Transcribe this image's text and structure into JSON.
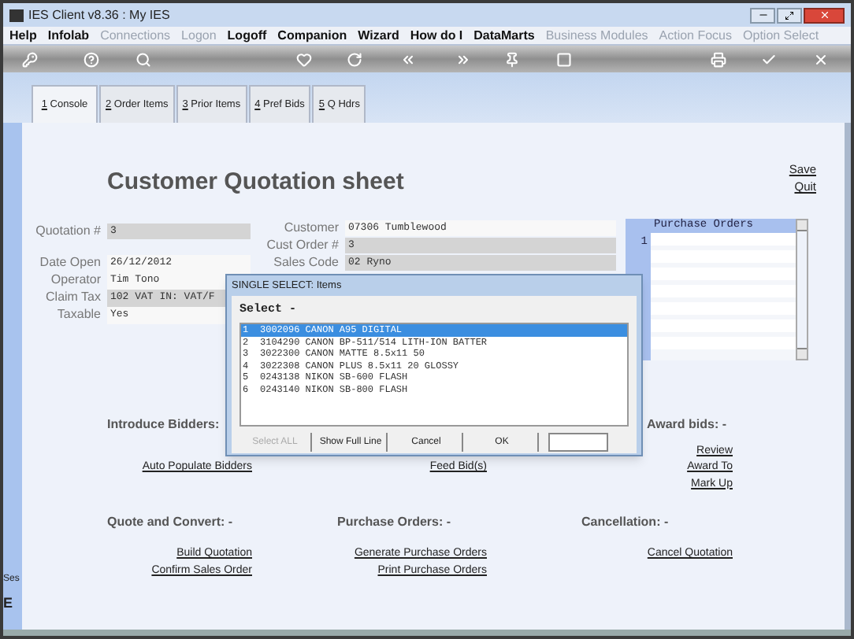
{
  "window": {
    "title": "IES Client v8.36 : My IES"
  },
  "menu": [
    {
      "label": "Help",
      "disabled": false
    },
    {
      "label": "Infolab",
      "disabled": false
    },
    {
      "label": "Connections",
      "disabled": true
    },
    {
      "label": "Logon",
      "disabled": true
    },
    {
      "label": "Logoff",
      "disabled": false
    },
    {
      "label": "Companion",
      "disabled": false
    },
    {
      "label": "Wizard",
      "disabled": false
    },
    {
      "label": "How do I",
      "disabled": false
    },
    {
      "label": "DataMarts",
      "disabled": false
    },
    {
      "label": "Business Modules",
      "disabled": true
    },
    {
      "label": "Action Focus",
      "disabled": true
    },
    {
      "label": "Option Select",
      "disabled": true
    }
  ],
  "tabs": [
    {
      "key": "1",
      "label": " Console",
      "selected": true
    },
    {
      "key": "2",
      "label": " Order Items",
      "selected": false
    },
    {
      "key": "3",
      "label": " Prior Items",
      "selected": false
    },
    {
      "key": "4",
      "label": " Pref Bids",
      "selected": false
    },
    {
      "key": "5",
      "label": " Q Hdrs",
      "selected": false
    }
  ],
  "page": {
    "title": "Customer Quotation sheet",
    "actions": [
      "Save",
      "Quit"
    ]
  },
  "left_fields": [
    {
      "label": "Quotation #",
      "value": "3",
      "kind": "locked"
    },
    {
      "label": "Date Open",
      "value": "26/12/2012",
      "kind": "open"
    },
    {
      "label": "Operator",
      "value": "Tim Tono",
      "kind": "open"
    },
    {
      "label": "Claim Tax",
      "value": "102 VAT IN: VAT/F",
      "kind": "locked"
    },
    {
      "label": "Taxable",
      "value": "Yes",
      "kind": "open"
    }
  ],
  "middle_fields": [
    {
      "label": "Customer",
      "value": "07306 Tumblewood",
      "kind": "open"
    },
    {
      "label": "Cust Order #",
      "value": "3",
      "kind": "locked"
    },
    {
      "label": "Sales Code",
      "value": "02 Ryno",
      "kind": "locked"
    }
  ],
  "purchase_orders": {
    "header": "Purchase Orders",
    "row_numbers": [
      "1"
    ]
  },
  "sections": [
    [
      {
        "title": "Introduce Bidders:",
        "links": [
          "Auto Populate Bidders"
        ]
      },
      {
        "links": [
          "Feed Bid(s)"
        ]
      },
      {
        "title": "Award bids: -",
        "links": [
          "Review",
          "Award To",
          "Mark Up"
        ]
      }
    ],
    [
      {
        "title": "Quote and Convert: -",
        "links": [
          "Build Quotation",
          "Confirm Sales Order"
        ]
      },
      {
        "title": "Purchase Orders: -",
        "links": [
          "Generate Purchase Orders",
          "Print Purchase Orders"
        ]
      },
      {
        "title": "Cancellation: -",
        "links": [
          "Cancel Quotation"
        ]
      }
    ]
  ],
  "side_strip": [
    "Ses",
    "E"
  ],
  "dialog": {
    "title": "SINGLE SELECT: Items",
    "heading": "Select -",
    "items": [
      {
        "number": "1",
        "text": "3002096 CANON A95 DIGITAL",
        "selected": true
      },
      {
        "number": "2",
        "text": "3104290 CANON BP-511/514 LITH-ION BATTER",
        "selected": false
      },
      {
        "number": "3",
        "text": "3022300 CANON MATTE 8.5x11 50",
        "selected": false
      },
      {
        "number": "4",
        "text": "3022308 CANON PLUS 8.5x11 20 GLOSSY",
        "selected": false
      },
      {
        "number": "5",
        "text": "0243138 NIKON SB-600 FLASH",
        "selected": false
      },
      {
        "number": "6",
        "text": "0243140 NIKON SB-800 FLASH",
        "selected": false
      }
    ],
    "buttons": [
      {
        "label": "Select ALL",
        "disabled": true
      },
      {
        "label": "Show Full Line",
        "disabled": false
      },
      {
        "label": "Cancel",
        "disabled": false
      },
      {
        "label": "OK",
        "disabled": false
      }
    ]
  }
}
